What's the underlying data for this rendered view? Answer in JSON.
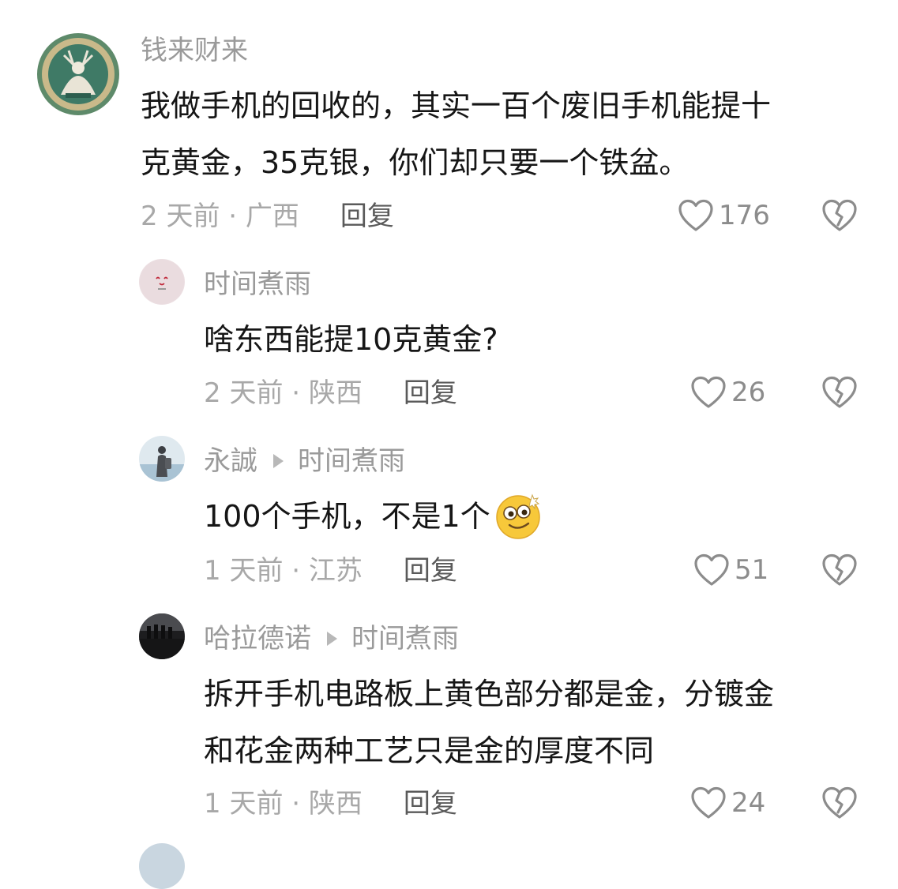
{
  "comments": [
    {
      "username": "钱来财来",
      "reply_to": "",
      "lines": [
        "我做手机的回收的，其实一百个废旧手机能提十",
        "克黄金，35克银，你们却只要一个铁盆。"
      ],
      "time_location": "2 天前 · 广西",
      "reply_label": "回复",
      "likes": "176"
    },
    {
      "username": "时间煮雨",
      "reply_to": "",
      "lines": [
        "啥东西能提10克黄金?"
      ],
      "time_location": "2 天前 · 陕西",
      "reply_label": "回复",
      "likes": "26"
    },
    {
      "username": "永誠",
      "reply_to": "时间煮雨",
      "lines": [
        "100个手机，不是1个"
      ],
      "emoji": "dizzy-smile-emoji",
      "time_location": "1 天前 · 江苏",
      "reply_label": "回复",
      "likes": "51"
    },
    {
      "username": "哈拉德诺",
      "reply_to": "时间煮雨",
      "lines": [
        "拆开手机电路板上黄色部分都是金，分镀金",
        "和花金两种工艺只是金的厚度不同"
      ],
      "time_location": "1 天前 · 陕西",
      "reply_label": "回复",
      "likes": "24"
    }
  ],
  "icons": {
    "like": "heart-outline-icon",
    "dislike": "broken-heart-icon",
    "reply_arrow": "triangle-right-icon"
  },
  "colors": {
    "username": "#9a9a9a",
    "content": "#161616",
    "meta": "#a8a8a8",
    "reply": "#5a5a5a",
    "icon": "#8c8c8c"
  }
}
